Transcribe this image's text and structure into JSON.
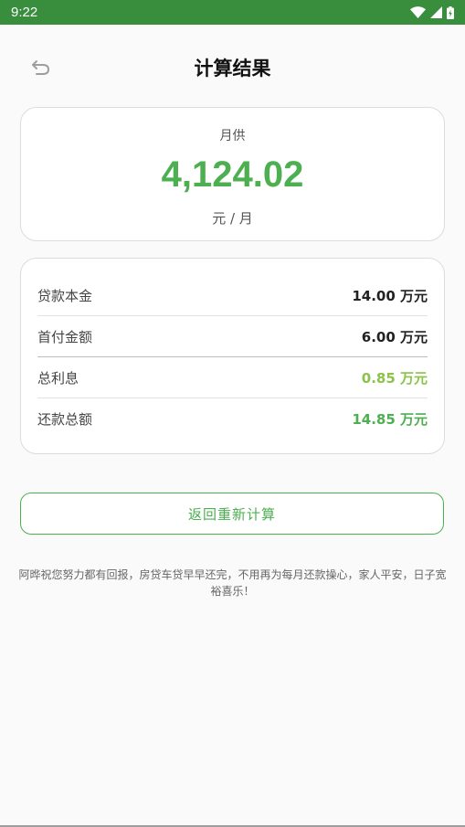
{
  "status_bar": {
    "time": "9:22",
    "icons": [
      "wifi-icon",
      "signal-icon",
      "battery-icon"
    ]
  },
  "header": {
    "title": "计算结果",
    "back_icon": "back-arrow-icon"
  },
  "summary": {
    "label": "月供",
    "value": "4,124.02",
    "unit": "元 / 月"
  },
  "details": [
    {
      "label": "贷款本金",
      "value": "14.00 万元"
    },
    {
      "label": "首付金额",
      "value": "6.00 万元"
    },
    {
      "label": "总利息",
      "value": "0.85 万元"
    },
    {
      "label": "还款总额",
      "value": "14.85 万元"
    }
  ],
  "actions": {
    "recalculate_label": "返回重新计算"
  },
  "footer": {
    "blessing": "阿晔祝您努力都有回报，房贷车贷早早还完，不用再为每月还款操心，家人平安，日子宽裕喜乐！"
  },
  "colors": {
    "status_bar": "#388e3c",
    "accent_green": "#4caf50",
    "interest_green": "#8bc34a"
  }
}
